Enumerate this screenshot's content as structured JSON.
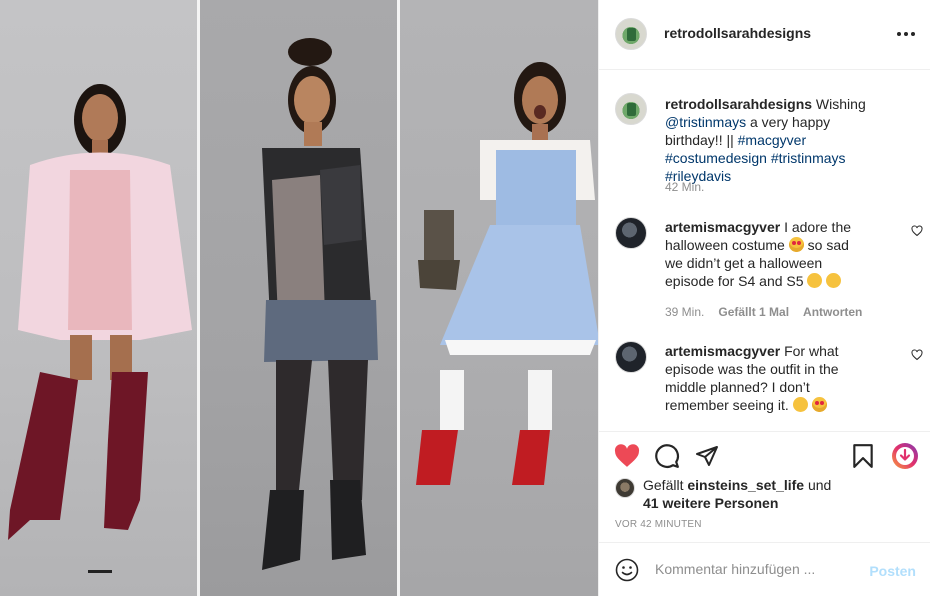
{
  "post": {
    "author": "retrodollsarahdesigns",
    "more_icon": "more-horizontal-icon",
    "more_label": "•••"
  },
  "caption": {
    "username": "retrodollsarahdesigns",
    "text1": " Wishing ",
    "mention": "@tristinmays",
    "text2": " a very happy birthday!! ||",
    "hashtags": [
      "#macgyver",
      "#costumedesign",
      "#tristinmays",
      "#rileydavis"
    ],
    "time": "42 Min."
  },
  "comments": [
    {
      "username": "artemismacgyver",
      "text_a": " I adore the halloween costume ",
      "text_b": " so sad we didn’t get a halloween episode for S4 and S5 ",
      "time": "39 Min.",
      "likes": "Gefällt 1 Mal",
      "reply": "Antworten"
    },
    {
      "username": "artemismacgyver",
      "text_a": " For what episode was the outfit in the middle planned? I don’t remember seeing it. ",
      "time": ""
    }
  ],
  "likes": {
    "prefix": "Gefällt ",
    "user": "einsteins_set_life",
    "mid": " und",
    "others": "41 weitere Personen"
  },
  "timestamp": "VOR 42 MINUTEN",
  "comment_box": {
    "placeholder": "Kommentar hinzufügen ...",
    "post_label": "Posten"
  },
  "colors": {
    "like_red": "#ed4956",
    "link_blue": "#00376b",
    "post_disabled": "#b2dffc"
  },
  "icons": [
    "heart-filled-icon",
    "comment-icon",
    "share-icon",
    "bookmark-icon",
    "emoji-icon",
    "heart-outline-icon"
  ]
}
